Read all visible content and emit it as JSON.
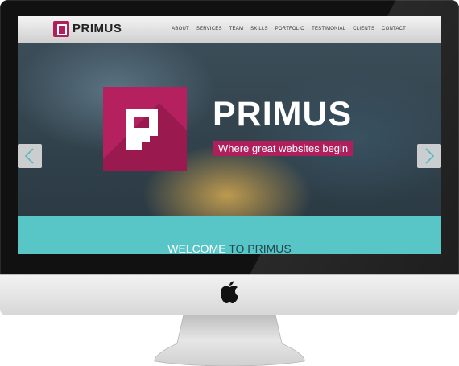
{
  "site": {
    "logo_text": "PRIMUS",
    "nav": [
      "ABOUT",
      "SERVICES",
      "TEAM",
      "SKILLS",
      "PORTFOLIO",
      "TESTIMONIAL",
      "CLIENTS",
      "CONTACT"
    ]
  },
  "hero": {
    "title": "PRIMUS",
    "tagline": "Where great websites begin"
  },
  "welcome": {
    "part1": "WELCOME",
    "part2": " TO PRIMUS"
  },
  "colors": {
    "brand": "#b01e5c",
    "accent_band": "#58c5c6"
  },
  "icons": [
    "apple-logo-icon",
    "chevron-left-icon",
    "chevron-right-icon"
  ]
}
